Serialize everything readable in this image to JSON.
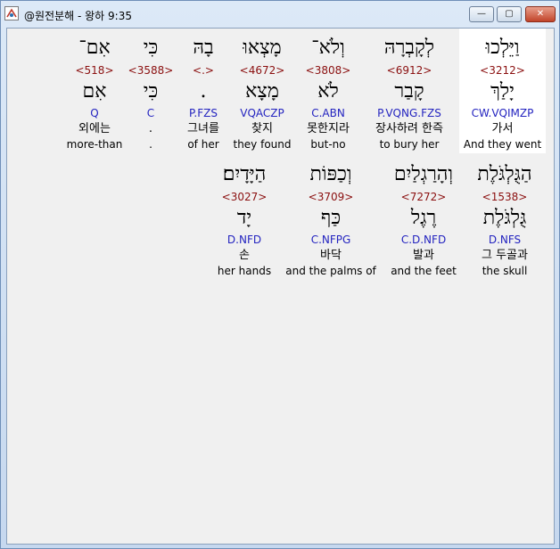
{
  "window": {
    "title": "@원전분해 - 왕하 9:35",
    "minimize_label": "—",
    "maximize_label": "▢",
    "close_label": "✕"
  },
  "rows": [
    {
      "words": [
        {
          "hebrew": "אִם־",
          "strong": "<518>",
          "lemma": "אִם",
          "morph": "Q",
          "korean": "외에는",
          "english": "more-than"
        },
        {
          "hebrew": "כִּי",
          "strong": "<3588>",
          "lemma": "כִּי",
          "morph": "C",
          "korean": ".",
          "english": "."
        },
        {
          "hebrew": "בָהּ",
          "strong": "<.>",
          "lemma": ".",
          "morph": "P.FZS",
          "korean": "그녀를",
          "english": "of her"
        },
        {
          "hebrew": "מָצְאוּ",
          "strong": "<4672>",
          "lemma": "מָצָא",
          "morph": "VQACZP",
          "korean": "찾지",
          "english": "they found"
        },
        {
          "hebrew": "וְלֹא־",
          "strong": "<3808>",
          "lemma": "לֹא",
          "morph": "C.ABN",
          "korean": "못한지라",
          "english": "but-no"
        },
        {
          "hebrew": "לְקָבְרָהּ",
          "strong": "<6912>",
          "lemma": "קָבַר",
          "morph": "P.VQNG.FZS",
          "korean": "장사하려 한즉",
          "english": "to bury her"
        },
        {
          "hebrew": "וַיֵּלְכוּ",
          "strong": "<3212>",
          "lemma": "יָלַךְ",
          "morph": "CW.VQIMZP",
          "korean": "가서",
          "english": "And they went"
        }
      ]
    },
    {
      "words": [
        {
          "hebrew": "הַיָּדָיִם׃",
          "strong": "<3027>",
          "lemma": "יָד",
          "morph": "D.NFD",
          "korean": "손",
          "english": "her hands"
        },
        {
          "hebrew": "וְכַפּוֹת",
          "strong": "<3709>",
          "lemma": "כַּף",
          "morph": "C.NFPG",
          "korean": "바닥",
          "english": "and the palms of"
        },
        {
          "hebrew": "וְהָרַגְלַיִם",
          "strong": "<7272>",
          "lemma": "רֶגֶל",
          "morph": "C.D.NFD",
          "korean": "발과",
          "english": "and the feet"
        },
        {
          "hebrew": "הַגֻּלְגֹּלֶת",
          "strong": "<1538>",
          "lemma": "גֻּלְגֹּלֶת",
          "morph": "D.NFS",
          "korean": "그 두골과",
          "english": "the skull"
        }
      ]
    }
  ]
}
